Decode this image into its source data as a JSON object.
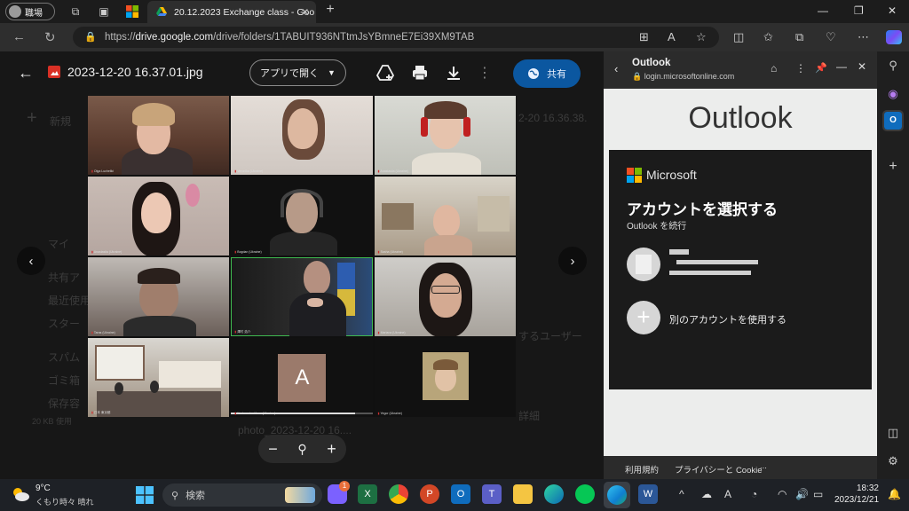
{
  "titlebar": {
    "profile": "職場",
    "tab_title": "20.12.2023 Exchange class - Goo"
  },
  "address": {
    "url_prefix": "https://",
    "url_host": "drive.google.com",
    "url_path": "/drive/folders/1TABUIT936NTtmJsYBmneE7Ei39XM9TAB"
  },
  "viewer": {
    "filename": "2023-12-20 16.37.01.jpg",
    "open_with": "アプリで開く",
    "share": "共有"
  },
  "drive_background": {
    "new": "新規",
    "left_items": [
      "マイ",
      "共有ア",
      "最近使用",
      "スター",
      "スパム",
      "ゴミ箱",
      "保存容"
    ],
    "storage": "20 KB 使用",
    "right_text_1": "2-20 16.36.38.",
    "right_text_2": "するユーザー",
    "right_text_3": "詳細",
    "file_row": "photo_2023-12-20 16...."
  },
  "participants": [
    {
      "name": "Olga Lucheliki"
    },
    {
      "name": "Veronika (Ukraine)"
    },
    {
      "name": "Anastasiia (Ukraine)"
    },
    {
      "name": "Anastasiia (Ukraine)"
    },
    {
      "name": "Bogdan (Ukraine)"
    },
    {
      "name": "Sasha (Ukraine)"
    },
    {
      "name": "Taras (Ukraine)"
    },
    {
      "name": "澤村 浩介"
    },
    {
      "name": "Mariana (Ukraine)"
    },
    {
      "name": "日本 東京都"
    },
    {
      "name": "Kasiamotsu Hana (Ukraine)"
    },
    {
      "name": "Yegor (Ukraine)"
    }
  ],
  "placeholder_letter": "A",
  "outlook": {
    "title": "Outlook",
    "url": "login.microsoftonline.com",
    "logo_text": "Outlook",
    "ms_name": "Microsoft",
    "heading": "アカウントを選択する",
    "subheading": "Outlook を続行",
    "use_other": "別のアカウントを使用する",
    "footer_terms": "利用規約",
    "footer_privacy": "プライバシーと Cookie",
    "footer_more": "..."
  },
  "taskbar": {
    "temp": "9°C",
    "weather": "くもり時々 晴れ",
    "search": "検索",
    "time": "18:32",
    "date": "2023/12/21",
    "badge": "1"
  },
  "colors": {
    "share_blue": "#0b57a0",
    "active_speaker": "#3fb950"
  }
}
